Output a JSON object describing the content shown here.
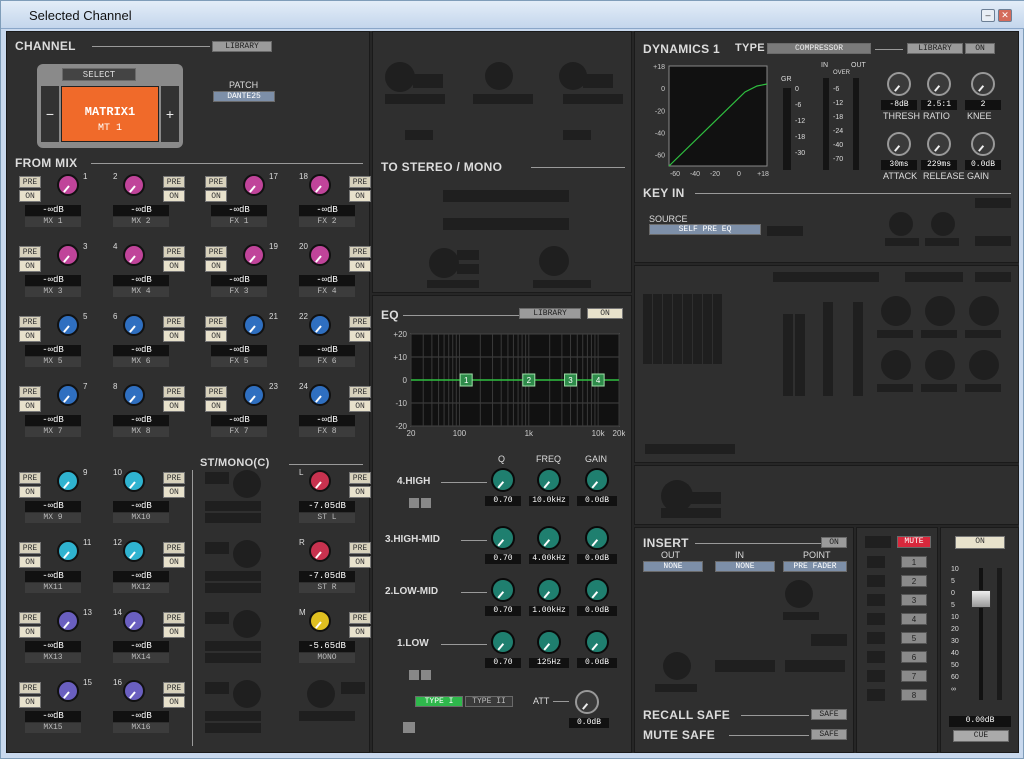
{
  "window": {
    "title": "Selected Channel",
    "min_icon": "minimize-icon",
    "close_icon": "close-icon"
  },
  "channel": {
    "section": "CHANNEL",
    "library": "LIBRARY",
    "select": "SELECT",
    "name": "MATRIX1",
    "sub": "MT 1",
    "patch_label": "PATCH",
    "patch_value": "DANTE25",
    "minus": "−",
    "plus": "+"
  },
  "from_mix": {
    "section": "FROM MIX",
    "stmono": "ST/MONO(C)",
    "pre": "PRE",
    "on": "ON",
    "sends": [
      {
        "num": "1",
        "val": "-∞dB",
        "name": "MX 1",
        "color": "#c0449a"
      },
      {
        "num": "2",
        "val": "-∞dB",
        "name": "MX 2",
        "color": "#c0449a"
      },
      {
        "num": "17",
        "val": "-∞dB",
        "name": "FX 1",
        "color": "#c0449a"
      },
      {
        "num": "18",
        "val": "-∞dB",
        "name": "FX 2",
        "color": "#c0449a"
      },
      {
        "num": "3",
        "val": "-∞dB",
        "name": "MX 3",
        "color": "#c0449a"
      },
      {
        "num": "4",
        "val": "-∞dB",
        "name": "MX 4",
        "color": "#c0449a"
      },
      {
        "num": "19",
        "val": "-∞dB",
        "name": "FX 3",
        "color": "#c0449a"
      },
      {
        "num": "20",
        "val": "-∞dB",
        "name": "FX 4",
        "color": "#c0449a"
      },
      {
        "num": "5",
        "val": "-∞dB",
        "name": "MX 5",
        "color": "#2f6fc0"
      },
      {
        "num": "6",
        "val": "-∞dB",
        "name": "MX 6",
        "color": "#2f6fc0"
      },
      {
        "num": "21",
        "val": "-∞dB",
        "name": "FX 5",
        "color": "#2f6fc0"
      },
      {
        "num": "22",
        "val": "-∞dB",
        "name": "FX 6",
        "color": "#2f6fc0"
      },
      {
        "num": "7",
        "val": "-∞dB",
        "name": "MX 7",
        "color": "#2f6fc0"
      },
      {
        "num": "8",
        "val": "-∞dB",
        "name": "MX 8",
        "color": "#2f6fc0"
      },
      {
        "num": "23",
        "val": "-∞dB",
        "name": "FX 7",
        "color": "#2f6fc0"
      },
      {
        "num": "24",
        "val": "-∞dB",
        "name": "FX 8",
        "color": "#2f6fc0"
      },
      {
        "num": "9",
        "val": "-∞dB",
        "name": "MX 9",
        "color": "#2fb3d0"
      },
      {
        "num": "10",
        "val": "-∞dB",
        "name": "MX10",
        "color": "#2fb3d0"
      },
      {
        "num": "11",
        "val": "-∞dB",
        "name": "MX11",
        "color": "#2fb3d0"
      },
      {
        "num": "12",
        "val": "-∞dB",
        "name": "MX12",
        "color": "#2fb3d0"
      },
      {
        "num": "13",
        "val": "-∞dB",
        "name": "MX13",
        "color": "#6a5fc0"
      },
      {
        "num": "14",
        "val": "-∞dB",
        "name": "MX14",
        "color": "#6a5fc0"
      },
      {
        "num": "15",
        "val": "-∞dB",
        "name": "MX15",
        "color": "#6a5fc0"
      },
      {
        "num": "16",
        "val": "-∞dB",
        "name": "MX16",
        "color": "#6a5fc0"
      }
    ],
    "st": [
      {
        "num": "L",
        "val": "-7.05dB",
        "name": "ST L",
        "color": "#c8324f"
      },
      {
        "num": "R",
        "val": "-7.05dB",
        "name": "ST R",
        "color": "#c8324f"
      },
      {
        "num": "M",
        "val": "-5.65dB",
        "name": "MONO",
        "color": "#e0c020"
      }
    ]
  },
  "to_stereo": {
    "section": "TO STEREO / MONO"
  },
  "eq": {
    "section": "EQ",
    "library": "LIBRARY",
    "on": "ON",
    "y_ticks": [
      "+20",
      "+10",
      "0",
      "-10",
      "-20"
    ],
    "x_ticks": [
      "20",
      "100",
      "1k",
      "10k",
      "20k"
    ],
    "bands_markers": [
      "1",
      "2",
      "3",
      "4"
    ],
    "col_q": "Q",
    "col_freq": "FREQ",
    "col_gain": "GAIN",
    "bands": [
      {
        "label": "4.HIGH",
        "q": "0.70",
        "freq": "10.0kHz",
        "gain": "0.0dB"
      },
      {
        "label": "3.HIGH-MID",
        "q": "0.70",
        "freq": "4.00kHz",
        "gain": "0.0dB"
      },
      {
        "label": "2.LOW-MID",
        "q": "0.70",
        "freq": "1.00kHz",
        "gain": "0.0dB"
      },
      {
        "label": "1.LOW",
        "q": "0.70",
        "freq": "125Hz",
        "gain": "0.0dB"
      }
    ],
    "type1": "TYPE I",
    "type2": "TYPE II",
    "att": "ATT",
    "att_val": "0.0dB"
  },
  "dynamics": {
    "section": "DYNAMICS 1",
    "type_label": "TYPE",
    "type": "COMPRESSOR",
    "library": "LIBRARY",
    "on": "ON",
    "graph_y": [
      "+18",
      "0",
      "-20",
      "-40",
      "-60"
    ],
    "graph_x": [
      "-60",
      "-40",
      "-20",
      "0",
      "+18"
    ],
    "gr": "GR",
    "gr_ticks": [
      "0",
      "-6",
      "-12",
      "-18",
      "-30"
    ],
    "in": "IN",
    "out": "OUT",
    "over": "OVER",
    "io_ticks": [
      "-6",
      "-12",
      "-18",
      "-24",
      "-40",
      "-70"
    ],
    "thresh": {
      "val": "-8dB",
      "label": "THRESH"
    },
    "ratio": {
      "val": "2.5:1",
      "label": "RATIO"
    },
    "knee": {
      "val": "2",
      "label": "KNEE"
    },
    "attack": {
      "val": "30ms",
      "label": "ATTACK"
    },
    "release": {
      "val": "229ms",
      "label": "RELEASE"
    },
    "gain": {
      "val": "0.0dB",
      "label": "GAIN"
    },
    "keyin": "KEY IN",
    "source_label": "SOURCE",
    "source": "SELF PRE EQ"
  },
  "insert": {
    "section": "INSERT",
    "on": "ON",
    "out_label": "OUT",
    "in_label": "IN",
    "point_label": "POINT",
    "out": "NONE",
    "in": "NONE",
    "point": "PRE FADER",
    "recall_safe": "RECALL SAFE",
    "mute_safe": "MUTE SAFE",
    "safe": "SAFE"
  },
  "mute": {
    "label": "MUTE",
    "groups": [
      "1",
      "2",
      "3",
      "4",
      "5",
      "6",
      "7",
      "8"
    ]
  },
  "fader": {
    "on": "ON",
    "ticks": [
      "10",
      "5",
      "0",
      "5",
      "10",
      "20",
      "30",
      "40",
      "50",
      "60",
      "∞"
    ],
    "value": "0.00dB",
    "cue": "CUE"
  }
}
